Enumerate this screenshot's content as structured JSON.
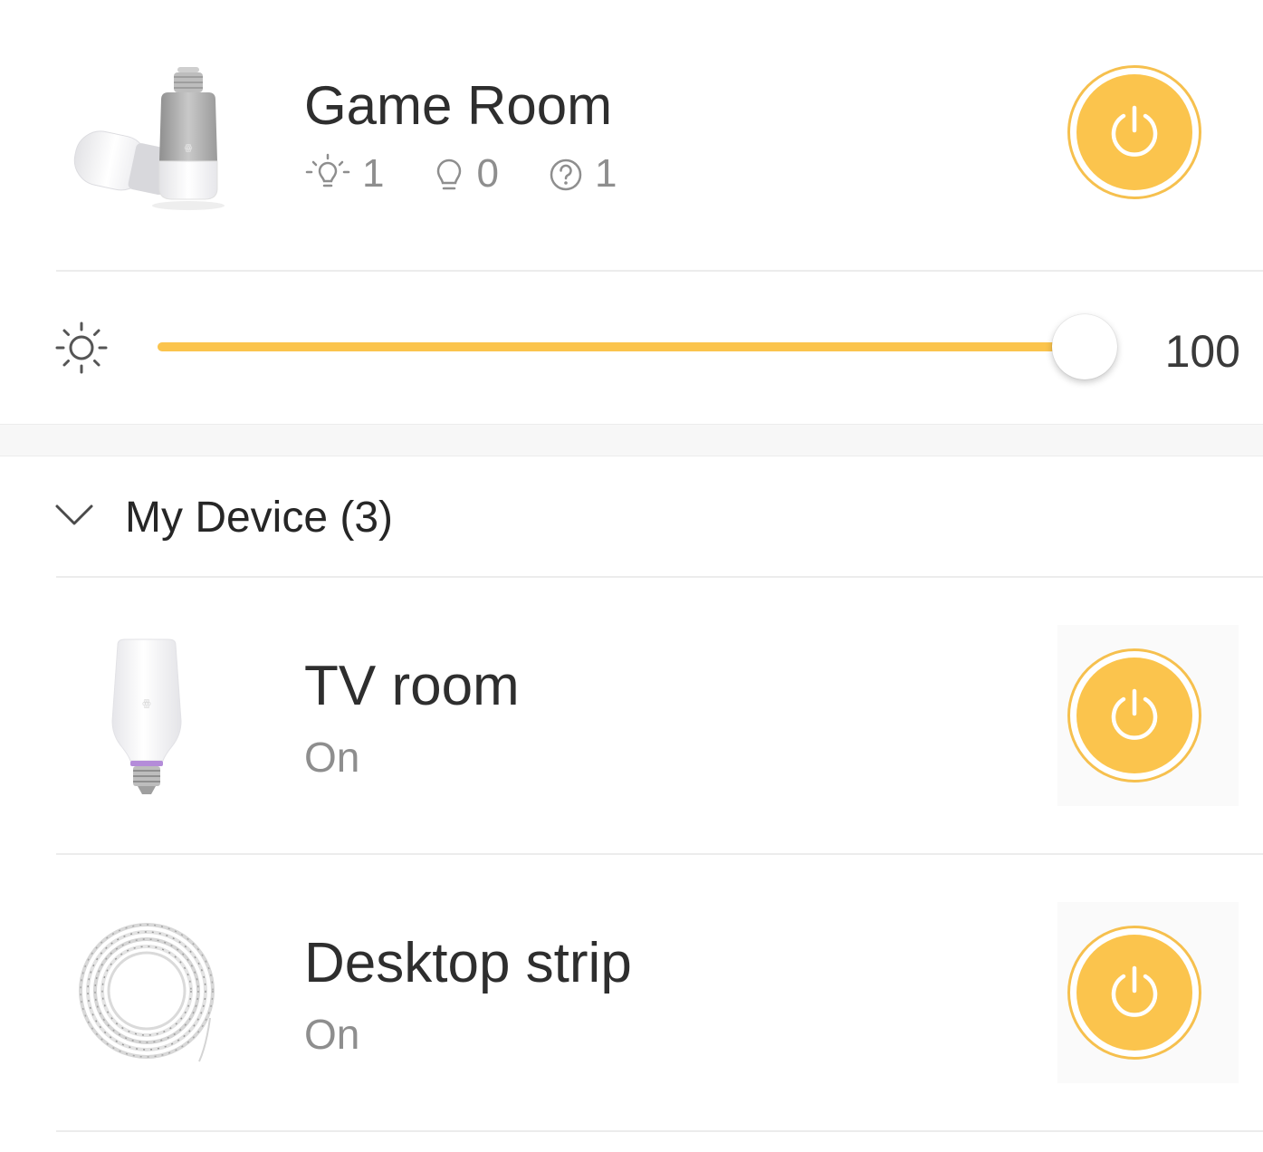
{
  "room": {
    "name": "Game Room",
    "stats": [
      {
        "icon": "bulb-on-icon",
        "value": "1"
      },
      {
        "icon": "bulb-off-icon",
        "value": "0"
      },
      {
        "icon": "question-circle-icon",
        "value": "1"
      }
    ],
    "image": "bulbs-image",
    "power": {
      "icon": "power-icon",
      "state": "on"
    }
  },
  "brightness": {
    "icon": "sun-icon",
    "value": 100,
    "display": "100",
    "max": 100
  },
  "section": {
    "title": "My Device (3)",
    "expand_icon": "chevron-down-icon"
  },
  "devices": [
    {
      "name": "TV room",
      "status": "On",
      "image": "color-bulb-image",
      "power_icon": "power-icon"
    },
    {
      "name": "Desktop strip",
      "status": "On",
      "image": "light-strip-image",
      "power_icon": "power-icon"
    }
  ],
  "colors": {
    "accent": "#fbc44d",
    "accent_ring": "#f6c04e",
    "text_primary": "#2e2e2e",
    "text_secondary": "#8e8e8e",
    "divider": "#ececec"
  }
}
